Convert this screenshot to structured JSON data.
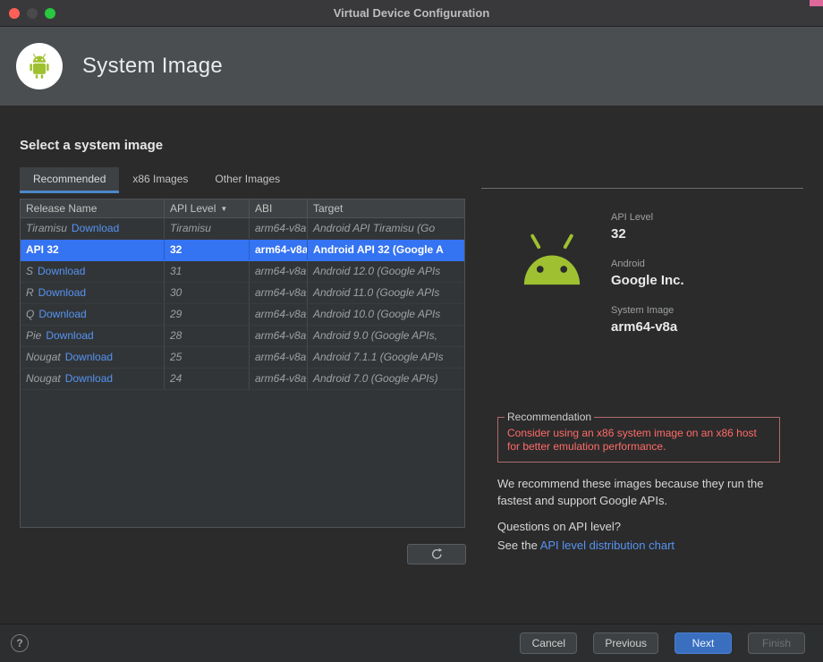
{
  "window": {
    "title": "Virtual Device Configuration"
  },
  "header": {
    "title": "System Image"
  },
  "main": {
    "heading": "Select a system image",
    "tabs": [
      {
        "label": "Recommended"
      },
      {
        "label": "x86 Images"
      },
      {
        "label": "Other Images"
      }
    ],
    "table": {
      "columns": [
        "Release Name",
        "API Level",
        "ABI",
        "Target"
      ],
      "sort_icon": "▼",
      "rows": [
        {
          "release": "Tiramisu",
          "download": "Download",
          "api": "Tiramisu",
          "abi": "arm64-v8a",
          "target": "Android API Tiramisu (Go"
        },
        {
          "release": "API 32",
          "download": "",
          "api": "32",
          "abi": "arm64-v8a",
          "target": "Android API 32 (Google A"
        },
        {
          "release": "S",
          "download": "Download",
          "api": "31",
          "abi": "arm64-v8a",
          "target": "Android 12.0 (Google APIs"
        },
        {
          "release": "R",
          "download": "Download",
          "api": "30",
          "abi": "arm64-v8a",
          "target": "Android 11.0 (Google APIs"
        },
        {
          "release": "Q",
          "download": "Download",
          "api": "29",
          "abi": "arm64-v8a",
          "target": "Android 10.0 (Google APIs"
        },
        {
          "release": "Pie",
          "download": "Download",
          "api": "28",
          "abi": "arm64-v8a",
          "target": "Android 9.0 (Google APIs,"
        },
        {
          "release": "Nougat",
          "download": "Download",
          "api": "25",
          "abi": "arm64-v8a",
          "target": "Android 7.1.1 (Google APIs"
        },
        {
          "release": "Nougat",
          "download": "Download",
          "api": "24",
          "abi": "arm64-v8a",
          "target": "Android 7.0 (Google APIs)"
        }
      ]
    }
  },
  "detail": {
    "api_level_label": "API Level",
    "api_level_value": "32",
    "vendor_label": "Android",
    "vendor_value": "Google Inc.",
    "system_image_label": "System Image",
    "system_image_value": "arm64-v8a",
    "recommendation_title": "Recommendation",
    "recommendation_text": "Consider using an x86 system image on an x86 host for better emulation performance.",
    "description": "We recommend these images because they run the fastest and support Google APIs.",
    "question": "Questions on API level?",
    "see_prefix": "See the ",
    "link_label": "API level distribution chart"
  },
  "footer": {
    "help_label": "?",
    "cancel_label": "Cancel",
    "previous_label": "Previous",
    "next_label": "Next",
    "finish_label": "Finish"
  },
  "colors": {
    "selection_blue": "#3473f2",
    "link_blue": "#5693f2",
    "accent_button": "#3a6fc0",
    "warning_red": "#ff6b68",
    "android_green": "#9fc131",
    "tab_underline": "#4a88c7"
  }
}
